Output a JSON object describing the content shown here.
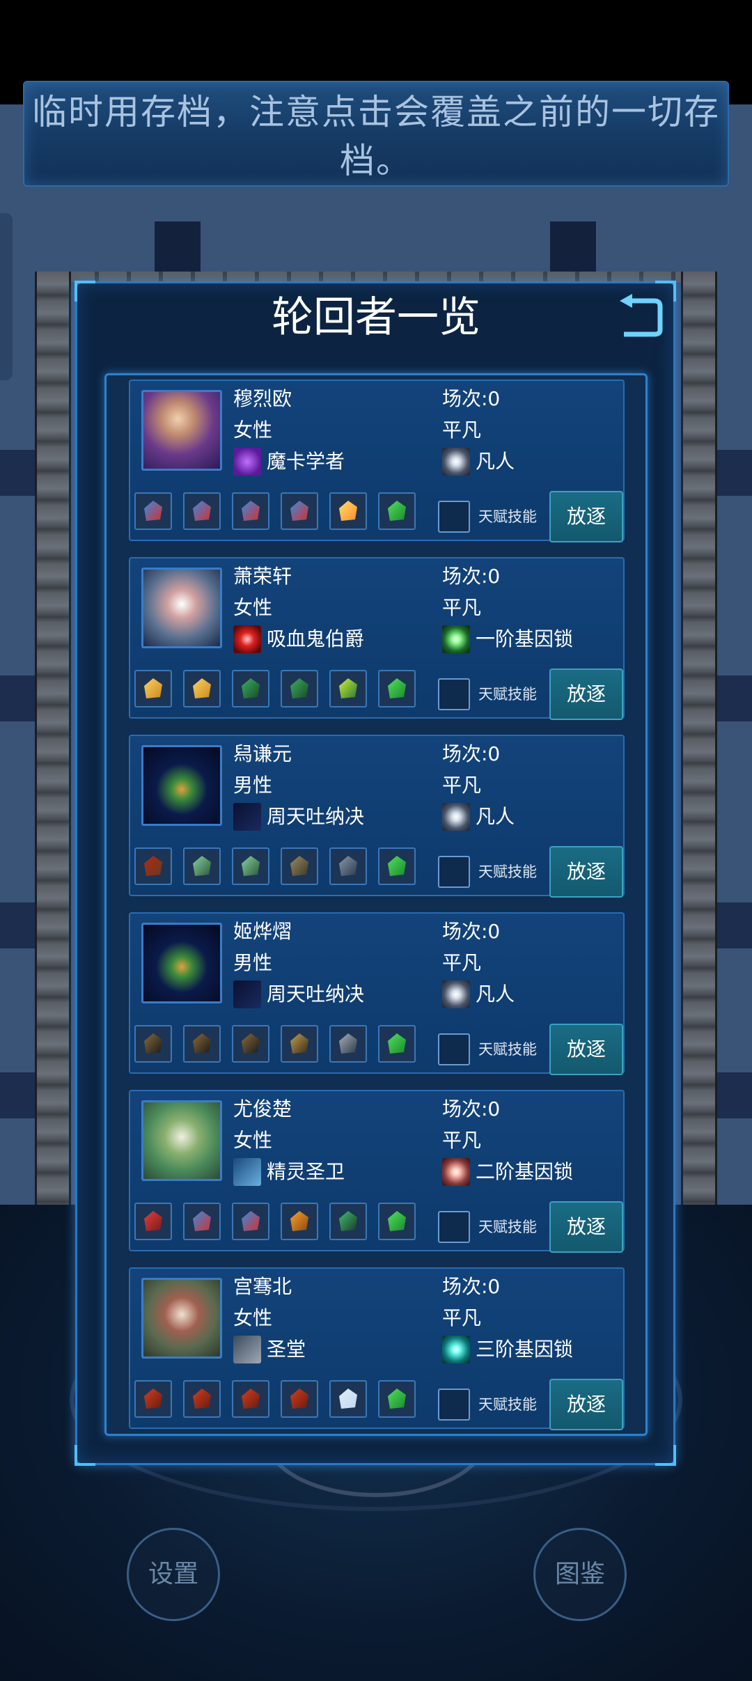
{
  "banner": {
    "text": "临时用存档，注意点击会覆盖之前的一切存档。"
  },
  "dialog": {
    "title": "轮回者一览",
    "back_icon": "return-arrow-icon"
  },
  "skill_label": "天赋技能",
  "exile_label": "放逐",
  "characters": [
    {
      "name": "穆烈欧",
      "gender": "女性",
      "class": "魔卡学者",
      "class_icon": "magic-card-icon",
      "matches": "场次:0",
      "level": "平凡",
      "rank": "凡人",
      "items": [
        "potion-icon",
        "potion-icon",
        "potion-icon",
        "potion-icon",
        "sun-orb-icon",
        "recycle-icon"
      ]
    },
    {
      "name": "萧荣轩",
      "gender": "女性",
      "class": "吸血鬼伯爵",
      "class_icon": "vampire-eye-icon",
      "matches": "场次:0",
      "level": "平凡",
      "rank": "一阶基因锁",
      "items": [
        "gold-ore-icon",
        "gold-ore-icon",
        "green-gem-icon",
        "green-gem-icon",
        "magic-staff-icon",
        "recycle-icon"
      ]
    },
    {
      "name": "舄谦元",
      "gender": "男性",
      "class": "周天吐纳决",
      "class_icon": "constellation-icon",
      "matches": "场次:0",
      "level": "平凡",
      "rank": "凡人",
      "items": [
        "helmet-icon",
        "leaf-blade-icon",
        "leaf-blade-icon",
        "armor-icon",
        "rifle-icon",
        "recycle-icon"
      ]
    },
    {
      "name": "姬烨熠",
      "gender": "男性",
      "class": "周天吐纳决",
      "class_icon": "constellation-icon",
      "matches": "场次:0",
      "level": "平凡",
      "rank": "凡人",
      "items": [
        "goggles-icon",
        "goggles-icon",
        "goggles-icon",
        "hat-icon",
        "assault-rifle-icon",
        "recycle-icon"
      ]
    },
    {
      "name": "尤俊楚",
      "gender": "女性",
      "class": "精灵圣卫",
      "class_icon": "elf-arrow-icon",
      "matches": "场次:0",
      "level": "平凡",
      "rank": "二阶基因锁",
      "items": [
        "red-crystal-icon",
        "potion-icon",
        "potion-icon",
        "fire-stone-icon",
        "green-dagger-icon",
        "recycle-icon"
      ]
    },
    {
      "name": "宫骞北",
      "gender": "女性",
      "class": "圣堂",
      "class_icon": "crossed-swords-icon",
      "matches": "场次:0",
      "level": "平凡",
      "rank": "三阶基因锁",
      "items": [
        "red-ore-icon",
        "red-ore-icon",
        "red-ore-icon",
        "red-ore-icon",
        "blaster-pistol-icon",
        "recycle-icon"
      ]
    }
  ],
  "bottom_buttons": {
    "settings": "设置",
    "codex": "图鉴"
  }
}
